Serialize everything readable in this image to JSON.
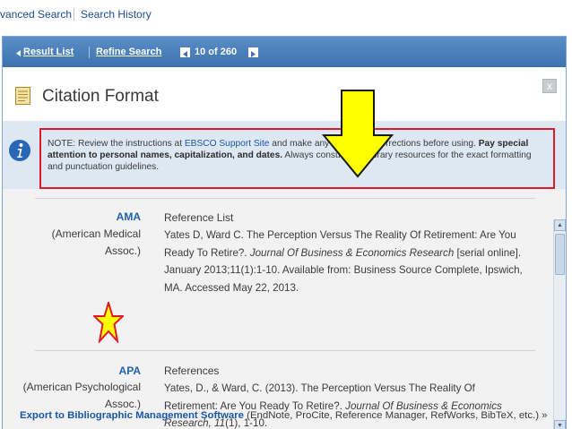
{
  "topbar": {
    "advanced_search": "vanced Search",
    "search_history": "Search History"
  },
  "navbar": {
    "result_list": "Result List",
    "refine_search": "Refine Search",
    "pagination": "10 of 260"
  },
  "dialog": {
    "title": "Citation Format",
    "close_label": "x"
  },
  "note": {
    "prefix": "NOTE: Review the instructions at ",
    "link": "EBSCO Support Site",
    "middle": " and make any necessary corrections before using. ",
    "bold": "Pay special attention to personal names, capitalization, and dates.",
    "suffix": " Always consult your library resources for the exact formatting and punctuation guidelines."
  },
  "citations": [
    {
      "style": "AMA",
      "sub1": "(American Medical",
      "sub2": "Assoc.)",
      "heading": "Reference List",
      "text_a": "Yates D, Ward C. The Perception Versus The Reality Of Retirement: Are You Ready To Retire?. ",
      "journal": "Journal Of Business & Economics Research",
      "text_b": " [serial online]. January 2013;11(1):1-10. Available from: Business Source Complete, Ipswich, MA. Accessed May 22, 2013."
    },
    {
      "style": "APA",
      "sub1": "(American Psychological",
      "sub2": "Assoc.)",
      "heading": "References",
      "text_a": "Yates, D., & Ward, C. (2013). The Perception Versus The Reality Of Retirement: Are You Ready To Retire?. ",
      "journal": "Journal Of Business & Economics Research, 11",
      "text_b": "(1), 1-10."
    }
  ],
  "export": {
    "link": "Export to Bibliographic Management Software",
    "rest": " (EndNote, ProCite, Reference Manager, RefWorks, BibTeX, etc.) »"
  },
  "colors": {
    "nav_blue": "#3d72b0",
    "link_blue": "#1a56a8",
    "highlight_red": "#e0192a",
    "annotation_yellow": "#ffff00"
  }
}
